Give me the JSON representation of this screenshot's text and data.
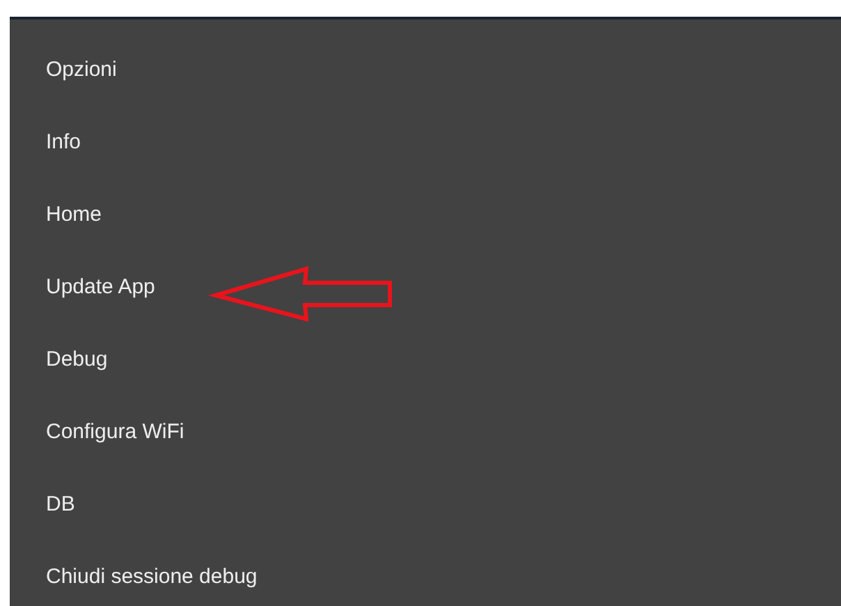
{
  "menu": {
    "items": [
      {
        "label": "Opzioni",
        "arrow_marked": false
      },
      {
        "label": "Info",
        "arrow_marked": false
      },
      {
        "label": "Home",
        "arrow_marked": false
      },
      {
        "label": "Update App",
        "arrow_marked": true
      },
      {
        "label": "Debug",
        "arrow_marked": false
      },
      {
        "label": "Configura WiFi",
        "arrow_marked": false
      },
      {
        "label": "DB",
        "arrow_marked": false
      },
      {
        "label": "Chiudi sessione debug",
        "arrow_marked": false
      }
    ]
  }
}
